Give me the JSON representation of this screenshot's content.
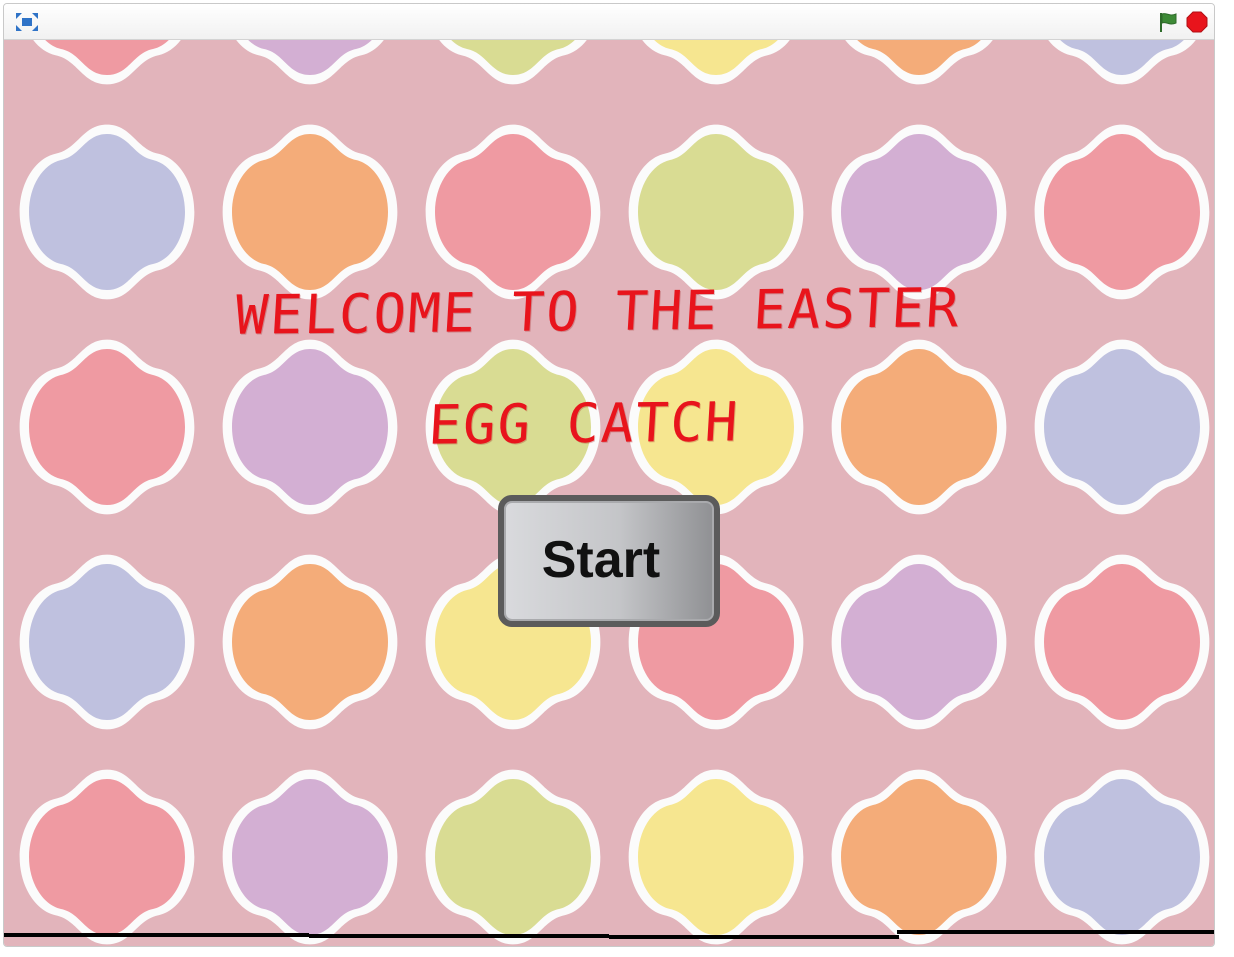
{
  "window": {
    "controls": {
      "fullscreen_icon": "fullscreen-icon",
      "green_flag_icon": "green-flag-icon",
      "stop_icon": "stop-icon"
    }
  },
  "stage": {
    "title_line_1": "WELCOME TO THE EASTER",
    "title_line_2": "EGG CATCH",
    "start_button_label": "Start"
  },
  "colors": {
    "title_red": "#e8141c",
    "background_pink": "#e2b4bb",
    "egg_blue": "#bfc1df",
    "egg_orange": "#f4ac79",
    "egg_red": "#ef9aa2",
    "egg_green": "#d9dc93",
    "egg_purple": "#d3afd3",
    "egg_yellow": "#f6e690",
    "flag_green": "#3d8a36",
    "stop_red": "#e8141c"
  }
}
